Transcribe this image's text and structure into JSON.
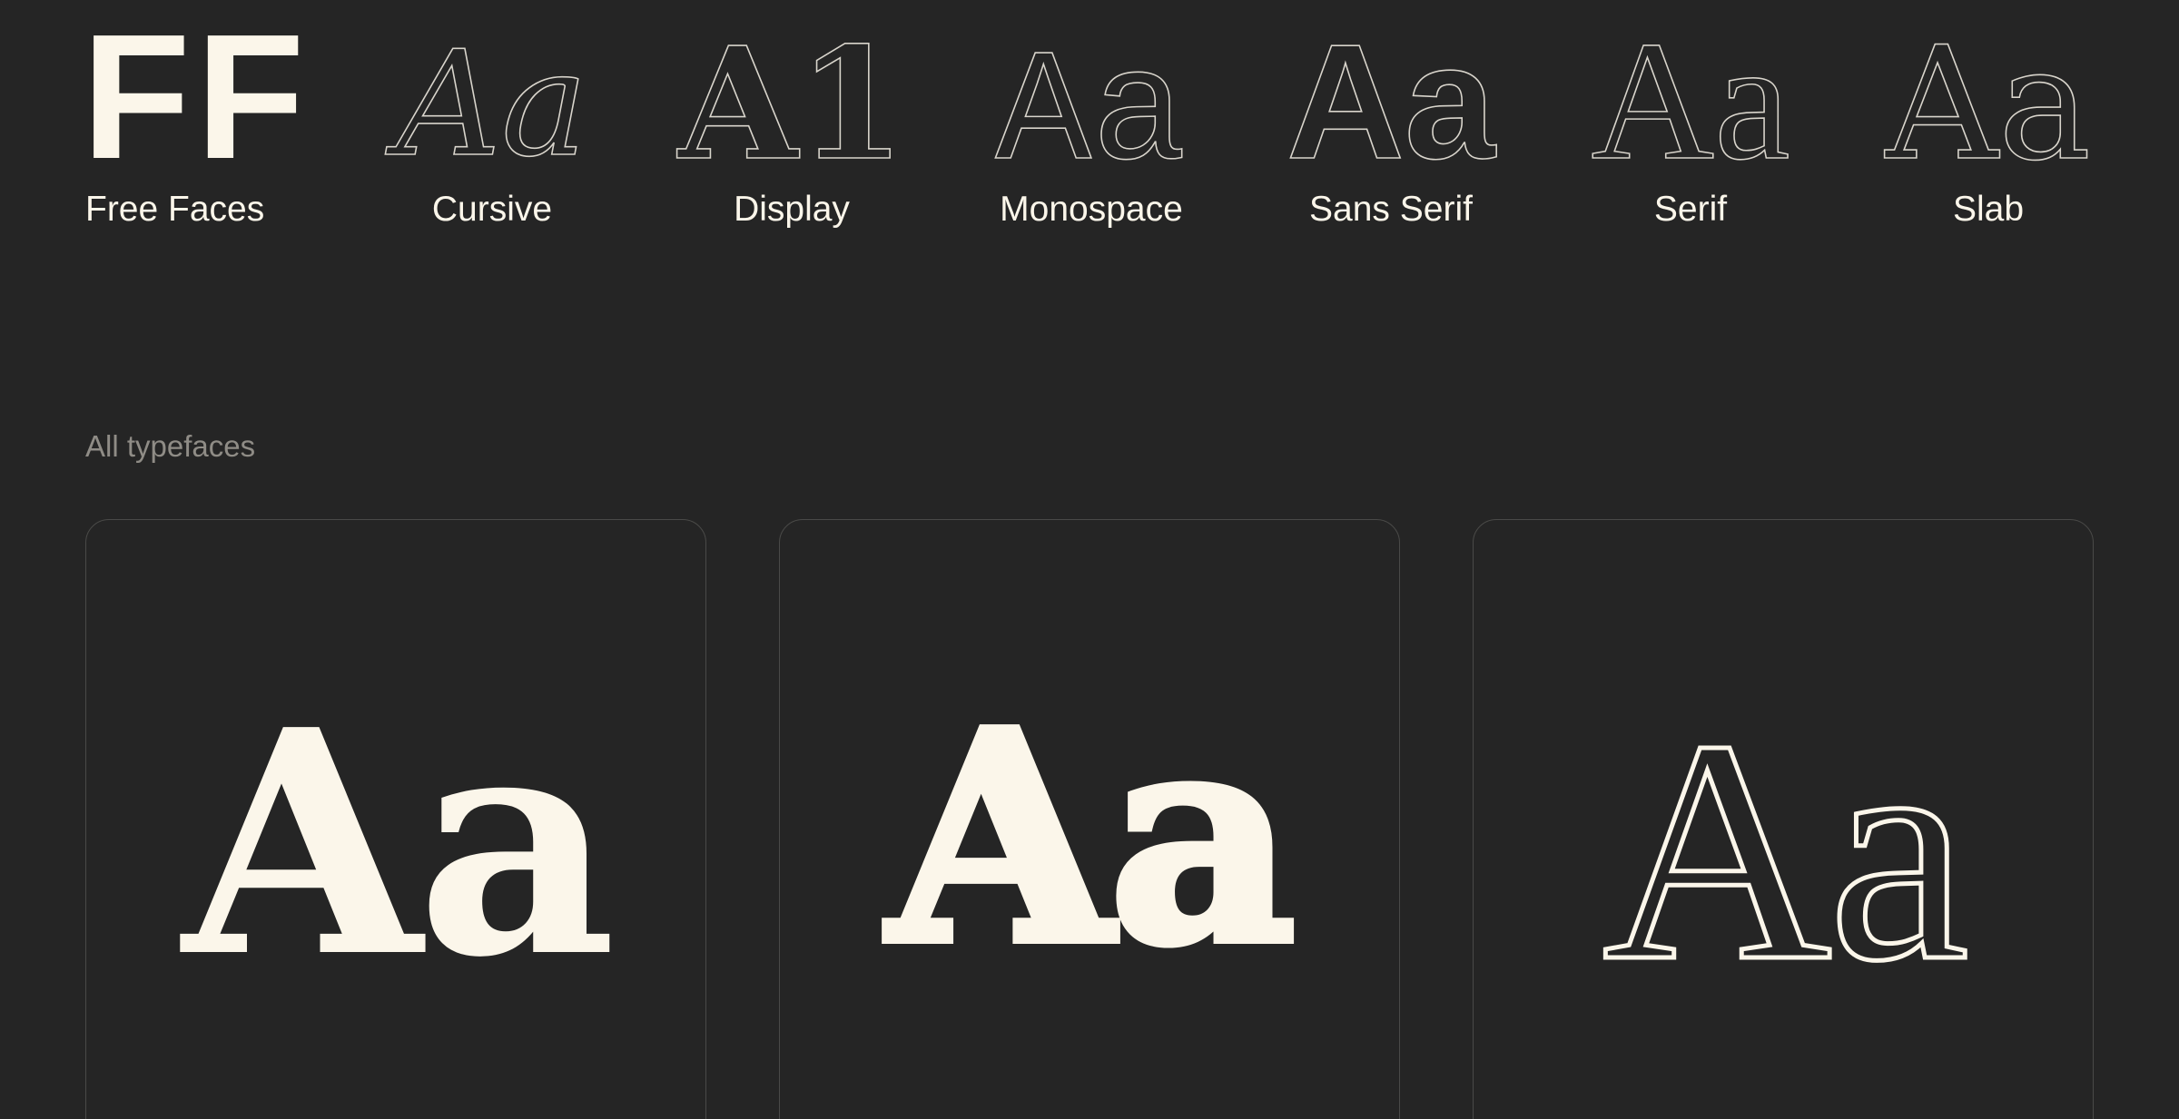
{
  "categories": {
    "free_faces": {
      "glyph": "FF",
      "label": "Free Faces"
    },
    "cursive": {
      "glyph": "Aa",
      "label": "Cursive"
    },
    "display": {
      "glyph": "A1",
      "label": "Display"
    },
    "monospace": {
      "glyph": "Aa",
      "label": "Monospace"
    },
    "sans_serif": {
      "glyph": "Aa",
      "label": "Sans Serif"
    },
    "serif": {
      "glyph": "Aa",
      "label": "Serif"
    },
    "slab": {
      "glyph": "Aa",
      "label": "Slab"
    }
  },
  "section": {
    "label": "All typefaces"
  },
  "cards": [
    {
      "specimen": "Aa"
    },
    {
      "specimen": "Aa"
    },
    {
      "specimen": "Aa"
    }
  ],
  "colors": {
    "background": "#252525",
    "cream": "#fbf6ea",
    "muted_text": "#8f8c86",
    "card_border": "#4a4a48"
  }
}
